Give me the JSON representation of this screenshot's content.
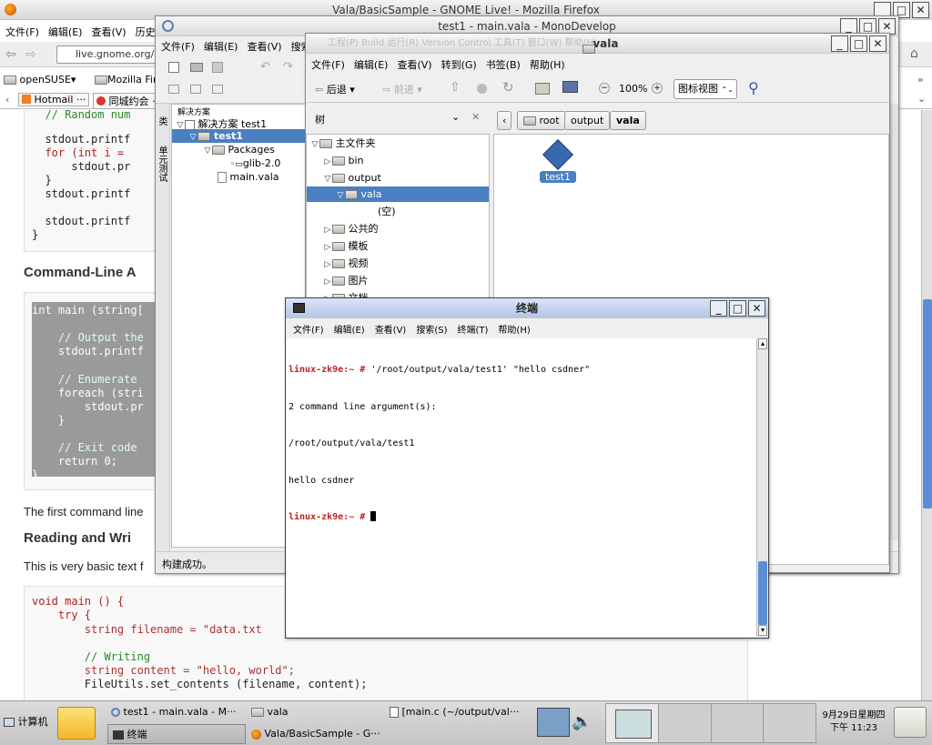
{
  "firefox": {
    "title": "Vala/BasicSample - GNOME Live! - Mozilla Firefox",
    "menu": [
      "文件(F)",
      "编辑(E)",
      "查看(V)",
      "历史(S"
    ],
    "url": "live.gnome.org/",
    "bookmarks": [
      "openSUSE",
      "Mozilla Fir"
    ],
    "tabs": [
      "Hotmail ···",
      "同城约会 ·"
    ],
    "code1": [
      "  // Random num",
      "",
      "  stdout.printf",
      "  for (int i = ",
      "      stdout.pr",
      "  }",
      "  stdout.printf",
      "",
      "  stdout.printf",
      "}"
    ],
    "heading1": "Command-Line A",
    "code2": [
      "int main (string[",
      "",
      "    // Output the",
      "    stdout.printf",
      "",
      "    // Enumerate ",
      "    foreach (stri",
      "        stdout.pr",
      "    }",
      "",
      "    // Exit code ",
      "    return 0;",
      "}"
    ],
    "para1": "The first command line",
    "heading2": "Reading and Wri",
    "para2": "This is very basic text f",
    "code3": [
      "void main () {",
      "    try {",
      "        string filename = \"data.txt",
      "",
      "        // Writing",
      "        string content = \"hello, world\";",
      "        FileUtils.set_contents (filename, content);"
    ]
  },
  "monodevelop": {
    "title": "test1 - main.vala - MonoDevelop",
    "menu": [
      "文件(F)",
      "编辑(E)",
      "查看(V)",
      "搜索"
    ],
    "menu_behind": [
      "工程(P)",
      "Build",
      "运行(R)",
      "Version Control",
      "工具(T)",
      "窗口(W)",
      "帮助(H)"
    ],
    "side_tabs": [
      "类",
      "单元测试"
    ],
    "solution_label": "解决方案",
    "tree": [
      {
        "label": "解决方案 test1",
        "level": 0
      },
      {
        "label": "test1",
        "level": 1,
        "selected": true
      },
      {
        "label": "Packages",
        "level": 2
      },
      {
        "label": "glib-2.0",
        "level": 3
      },
      {
        "label": "main.vala",
        "level": 2
      }
    ],
    "status": "构建成功。"
  },
  "nautilus": {
    "title": "vala",
    "menu": [
      "文件(F)",
      "编辑(E)",
      "查看(V)",
      "转到(G)",
      "书签(B)",
      "帮助(H)"
    ],
    "back": "后退",
    "forward": "前进",
    "zoom": "100%",
    "view_mode": "图标视图",
    "side_title": "树",
    "crumbs": [
      "root",
      "output",
      "vala"
    ],
    "tree": [
      {
        "label": "主文件夹",
        "level": 0,
        "expanded": true
      },
      {
        "label": "bin",
        "level": 1
      },
      {
        "label": "output",
        "level": 1,
        "expanded": true
      },
      {
        "label": "vala",
        "level": 2,
        "expanded": true,
        "selected": true
      },
      {
        "label": "(空)",
        "level": 4
      },
      {
        "label": "公共的",
        "level": 1
      },
      {
        "label": "模板",
        "level": 1
      },
      {
        "label": "视频",
        "level": 1
      },
      {
        "label": "图片",
        "level": 1
      },
      {
        "label": "文档",
        "level": 1
      }
    ],
    "file": "test1"
  },
  "terminal": {
    "title": "终端",
    "menu": [
      "文件(F)",
      "编辑(E)",
      "查看(V)",
      "搜索(S)",
      "终端(T)",
      "帮助(H)"
    ],
    "lines": [
      {
        "prompt": "linux-zk9e:~ # ",
        "text": "'/root/output/vala/test1' \"hello csdner\""
      },
      {
        "prompt": "",
        "text": "2 command line argument(s):"
      },
      {
        "prompt": "",
        "text": "/root/output/vala/test1"
      },
      {
        "prompt": "",
        "text": "hello csdner"
      },
      {
        "prompt": "linux-zk9e:~ # ",
        "text": ""
      }
    ]
  },
  "taskbar": {
    "computer": "计算机",
    "tasks": [
      "test1 - main.vala - M···",
      "vala",
      "[main.c (~/output/val···",
      "终端",
      "Vala/BasicSample - G···"
    ],
    "date": "9月29日星期四",
    "time": "下午 11:23"
  }
}
